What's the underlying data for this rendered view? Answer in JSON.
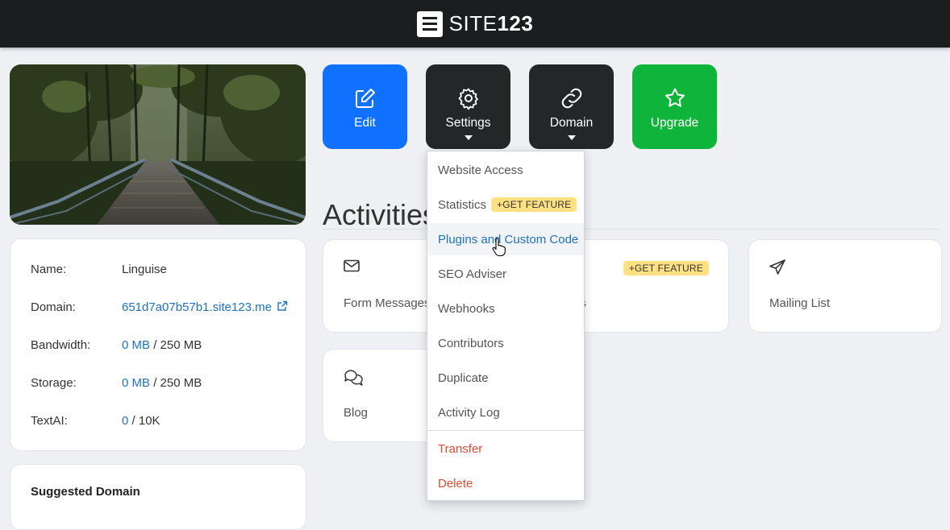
{
  "brand": {
    "name_part1": "SITE",
    "name_part2": "123"
  },
  "site_info": {
    "name_label": "Name:",
    "name_value": "Linguise",
    "domain_label": "Domain:",
    "domain_value": "651d7a07b57b1.site123.me",
    "bandwidth_label": "Bandwidth:",
    "bandwidth_used": "0 MB",
    "bandwidth_total": "/ 250 MB",
    "storage_label": "Storage:",
    "storage_used": "0 MB",
    "storage_total": "/ 250 MB",
    "textai_label": "TextAI:",
    "textai_used": "0",
    "textai_total": "/ 10K"
  },
  "suggested_domain": {
    "title": "Suggested Domain"
  },
  "actions": {
    "edit": "Edit",
    "settings": "Settings",
    "domain": "Domain",
    "upgrade": "Upgrade"
  },
  "activities": {
    "title": "Activities",
    "tiles": {
      "form_messages": "Form Messages",
      "languages_partial": "uages",
      "mailing_list": "Mailing List",
      "blog": "Blog"
    },
    "get_feature_badge": "+GET FEATURE"
  },
  "settings_menu": {
    "items": [
      "Website Access",
      "Statistics",
      "Plugins and Custom Code",
      "SEO Adviser",
      "Webhooks",
      "Contributors",
      "Duplicate",
      "Activity Log",
      "Transfer",
      "Delete"
    ],
    "statistics_badge": "+GET FEATURE",
    "hovered_item": "Plugins and Custom Code"
  },
  "colors": {
    "topbar": "#1b1d1f",
    "edit": "#1070ff",
    "settings": "#242628",
    "domain": "#242628",
    "upgrade": "#0fb53a",
    "link": "#1e73be",
    "danger": "#dd4a35",
    "badge": "#ffe082"
  }
}
